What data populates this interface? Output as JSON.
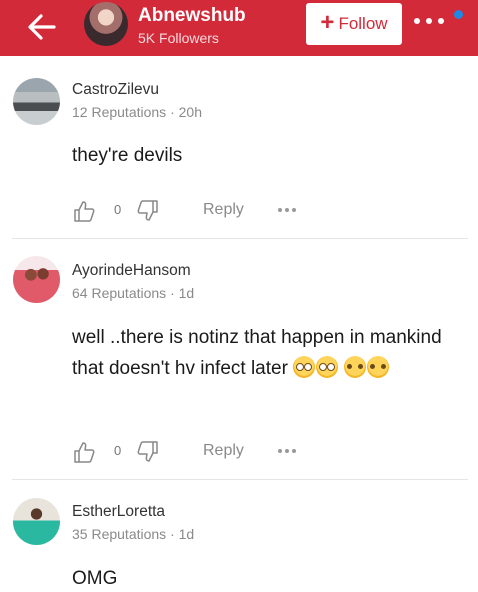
{
  "header": {
    "title": "Abnewshub",
    "followers": "5K Followers",
    "follow_label": "Follow",
    "follow_icon": "plus-icon",
    "back_icon": "back-arrow-icon",
    "more_icon": "more-dots-icon",
    "accent_color": "#d32a3a",
    "notification_color": "#1e88e5"
  },
  "comments": [
    {
      "username": "CastroZilevu",
      "reputation": "12 Reputations",
      "time": "20h",
      "text": "they're devils",
      "like_count": "0",
      "reply_label": "Reply"
    },
    {
      "username": "AyorindeHansom",
      "reputation": "64 Reputations",
      "time": "1d",
      "text": "well ..there is notinz that happen in mankind that doesn't hv infect later",
      "emojis": [
        "face-with-rolling-eyes",
        "face-with-rolling-eyes",
        "thinking-face",
        "thinking-face"
      ],
      "like_count": "0",
      "reply_label": "Reply"
    },
    {
      "username": "EstherLoretta",
      "reputation": "35 Reputations",
      "time": "1d",
      "text": "OMG"
    }
  ]
}
